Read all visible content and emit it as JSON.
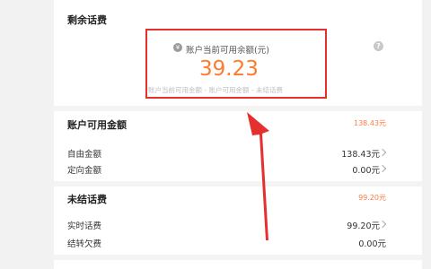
{
  "remaining": {
    "title": "剩余话费",
    "balance_label": "账户当前可用余额(元)",
    "balance_value": "39.23",
    "formula": "账户当前可用金额 - 账户可用金额 - 未结话费",
    "help_icon": "?"
  },
  "available": {
    "title": "账户可用金额",
    "total": "138.43元",
    "rows": [
      {
        "label": "自由金额",
        "value": "138.43元"
      },
      {
        "label": "定向金额",
        "value": "0.00元"
      }
    ]
  },
  "unsettled": {
    "title": "未结话费",
    "total": "99.20元",
    "rows": [
      {
        "label": "实时话费",
        "value": "99.20元"
      },
      {
        "label": "结转欠费",
        "value": "0.00元"
      }
    ]
  },
  "colors": {
    "accent": "#ff7a2d",
    "highlight_box": "#e63030",
    "arrow": "#e63030"
  },
  "icons": {
    "wallet": "wallet-icon",
    "help": "help-icon",
    "chevron": "chevron-right-icon"
  }
}
